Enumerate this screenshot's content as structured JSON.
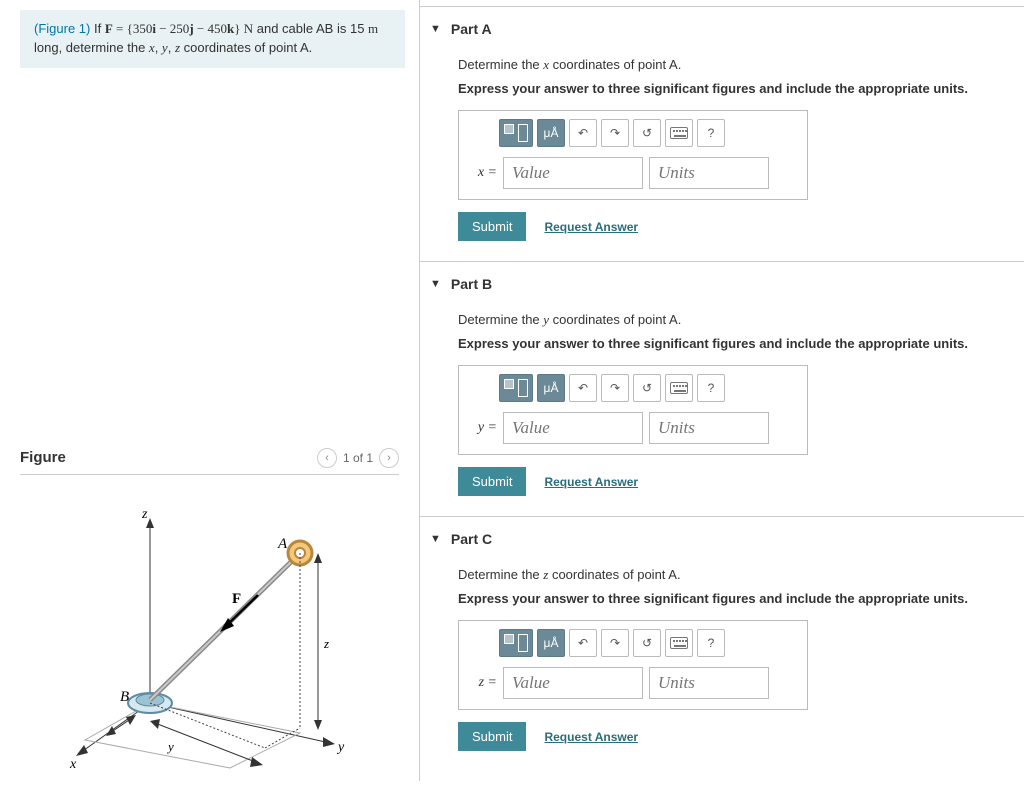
{
  "problem": {
    "figure_link": "(Figure 1)",
    "text_prefix": " If ",
    "force_expr_lhs": "F",
    "force_expr_eq": " = {350",
    "unit_i": "i",
    "minus1": "  −  250",
    "unit_j": "j",
    "minus2": "  −  450",
    "unit_k": "k",
    "force_unit": "} N",
    "text_mid": " and cable AB is 15 ",
    "length_unit": "m",
    "text_suffix": " long, determine the ",
    "var_x": "x",
    "comma1": ", ",
    "var_y": "y",
    "comma2": ", ",
    "var_z": "z",
    "text_end": " coordinates of point A."
  },
  "figure": {
    "title": "Figure",
    "counter": "1 of 1",
    "labels": {
      "A": "A",
      "B": "B",
      "F": "F",
      "x": "x",
      "y": "y",
      "z": "z",
      "zdim": "z",
      "ydim": "y"
    }
  },
  "toolbar": {
    "units_label": "μÅ",
    "help_label": "?"
  },
  "parts": [
    {
      "title": "Part A",
      "prompt_prefix": "Determine the ",
      "prompt_var": "x",
      "prompt_suffix": " coordinates of point A.",
      "instruction": "Express your answer to three significant figures and include the appropriate units.",
      "var_label": "x =",
      "value_placeholder": "Value",
      "units_placeholder": "Units",
      "submit": "Submit",
      "request": "Request Answer"
    },
    {
      "title": "Part B",
      "prompt_prefix": "Determine the ",
      "prompt_var": "y",
      "prompt_suffix": " coordinates of point A.",
      "instruction": "Express your answer to three significant figures and include the appropriate units.",
      "var_label": "y =",
      "value_placeholder": "Value",
      "units_placeholder": "Units",
      "submit": "Submit",
      "request": "Request Answer"
    },
    {
      "title": "Part C",
      "prompt_prefix": "Determine the ",
      "prompt_var": "z",
      "prompt_suffix": " coordinates of point A.",
      "instruction": "Express your answer to three significant figures and include the appropriate units.",
      "var_label": "z =",
      "value_placeholder": "Value",
      "units_placeholder": "Units",
      "submit": "Submit",
      "request": "Request Answer"
    }
  ]
}
